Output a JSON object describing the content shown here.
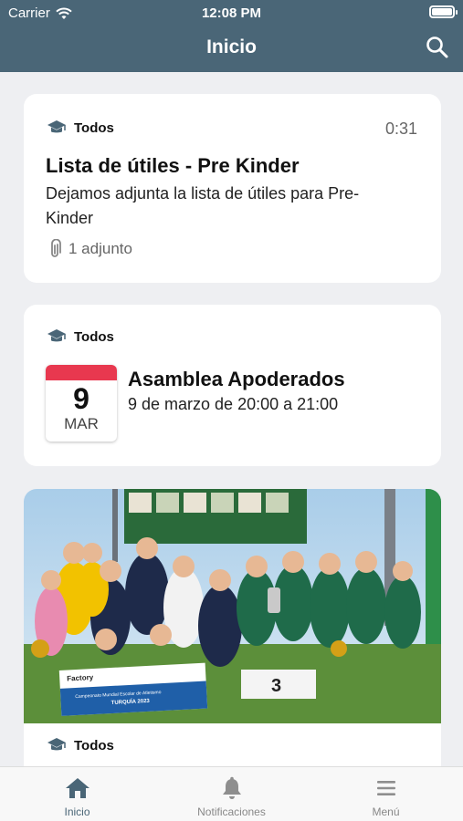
{
  "status_bar": {
    "carrier": "Carrier",
    "time": "12:08 PM"
  },
  "header": {
    "title": "Inicio"
  },
  "feed": [
    {
      "audience": "Todos",
      "time_ago": "0:31",
      "title": "Lista de útiles - Pre Kinder",
      "body": "Dejamos adjunta la lista de útiles para Pre-Kinder",
      "attachments": "1 adjunto"
    },
    {
      "audience": "Todos",
      "calendar": {
        "day": "9",
        "month": "MAR"
      },
      "title": "Asamblea Apoderados",
      "subtitle": "9 de marzo de 20:00 a 21:00"
    },
    {
      "audience": "Todos",
      "photo": {
        "banner_brand": "Factory",
        "banner_line1": "Campeonato Mundial Escolar de Atletismo",
        "banner_line2": "TURQUÍA 2023",
        "podium": "3"
      }
    }
  ],
  "tabs": [
    {
      "label": "Inicio",
      "icon": "home-icon",
      "active": true
    },
    {
      "label": "Notificaciones",
      "icon": "bell-icon",
      "active": false
    },
    {
      "label": "Menú",
      "icon": "menu-icon",
      "active": false
    }
  ],
  "colors": {
    "header": "#4a6677",
    "calendar_accent": "#e8384f",
    "tab_active": "#4a6677",
    "tab_inactive": "#8e8e8e"
  }
}
